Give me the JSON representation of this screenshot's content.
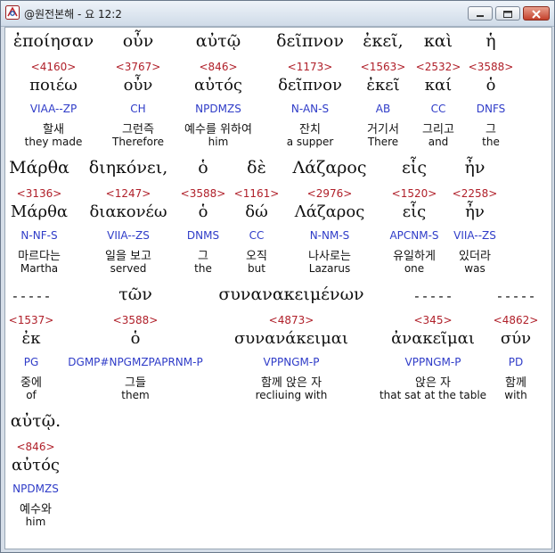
{
  "window": {
    "title": "@원전본해 - 요 12:2"
  },
  "colors": {
    "strong": "#b0202a",
    "parse": "#2f3cc8",
    "text": "#111111"
  },
  "rows": [
    {
      "words": [
        {
          "greek": "ἐποίησαν",
          "strong": "<4160>",
          "lemma": "ποιέω",
          "parse": "VIAA--ZP",
          "korean": "할새",
          "english": "they made"
        },
        {
          "greek": "οὖν",
          "strong": "<3767>",
          "lemma": "οὖν",
          "parse": "CH",
          "korean": "그런즉",
          "english": "Therefore"
        },
        {
          "greek": "αὐτῷ",
          "strong": "<846>",
          "lemma": "αὐτός",
          "parse": "NPDMZS",
          "korean": "예수를 위하여",
          "english": "him"
        },
        {
          "greek": "δεῖπνον",
          "strong": "<1173>",
          "lemma": "δεῖπνον",
          "parse": "N-AN-S",
          "korean": "잔치",
          "english": "a supper"
        },
        {
          "greek": "ἐκεῖ,",
          "strong": "<1563>",
          "lemma": "ἐκεῖ",
          "parse": "AB",
          "korean": "거기서",
          "english": "There"
        },
        {
          "greek": "καὶ",
          "strong": "<2532>",
          "lemma": "καί",
          "parse": "CC",
          "korean": "그리고",
          "english": "and"
        },
        {
          "greek": "ἡ",
          "strong": "<3588>",
          "lemma": "ὁ",
          "parse": "DNFS",
          "korean": "그",
          "english": "the"
        }
      ]
    },
    {
      "words": [
        {
          "greek": "Μάρθα",
          "strong": "<3136>",
          "lemma": "Μάρθα",
          "parse": "N-NF-S",
          "korean": "마르다는",
          "english": "Martha"
        },
        {
          "greek": "διηκόνει,",
          "strong": "<1247>",
          "lemma": "διακονέω",
          "parse": "VIIA--ZS",
          "korean": "일을 보고",
          "english": "served"
        },
        {
          "greek": "ὁ",
          "strong": "<3588>",
          "lemma": "ὁ",
          "parse": "DNMS",
          "korean": "그",
          "english": "the"
        },
        {
          "greek": "δὲ",
          "strong": "<1161>",
          "lemma": "δώ",
          "parse": "CC",
          "korean": "오직",
          "english": "but"
        },
        {
          "greek": "Λάζαρος",
          "strong": "<2976>",
          "lemma": "Λάζαρος",
          "parse": "N-NM-S",
          "korean": "나사로는",
          "english": "Lazarus"
        },
        {
          "greek": "εἷς",
          "strong": "<1520>",
          "lemma": "εἷς",
          "parse": "APCNM-S",
          "korean": "유일하게",
          "english": "one"
        },
        {
          "greek": "ἦν",
          "strong": "<2258>",
          "lemma": "ἦν",
          "parse": "VIIA--ZS",
          "korean": "있더라",
          "english": "was"
        }
      ]
    },
    {
      "words": [
        {
          "greek": "-----",
          "strong": "<1537>",
          "lemma": "ἐκ",
          "parse": "PG",
          "korean": "중에",
          "english": "of"
        },
        {
          "greek": "τῶν",
          "strong": "<3588>",
          "lemma": "ὁ",
          "parse": "DGMP#NPGMZPAPRNM-P",
          "korean": "그들",
          "english": "them"
        },
        {
          "greek": "συνανακειμένων",
          "strong": "<4873>",
          "lemma": "συνανάκειμαι",
          "parse": "VPPNGM-P",
          "korean": "함께 앉은 자",
          "english": "recliuing with"
        },
        {
          "greek": "-----",
          "strong": "<345>",
          "lemma": "ἀνακεῖμαι",
          "parse": "VPPNGM-P",
          "korean": "앉은 자",
          "english": "that sat at the table"
        },
        {
          "greek": "-----",
          "strong": "<4862>",
          "lemma": "σύν",
          "parse": "PD",
          "korean": "함께",
          "english": "with"
        }
      ]
    },
    {
      "words": [
        {
          "greek": "αὐτῷ.",
          "strong": "<846>",
          "lemma": "αὐτός",
          "parse": "NPDMZS",
          "korean": "예수와",
          "english": "him"
        }
      ]
    }
  ]
}
